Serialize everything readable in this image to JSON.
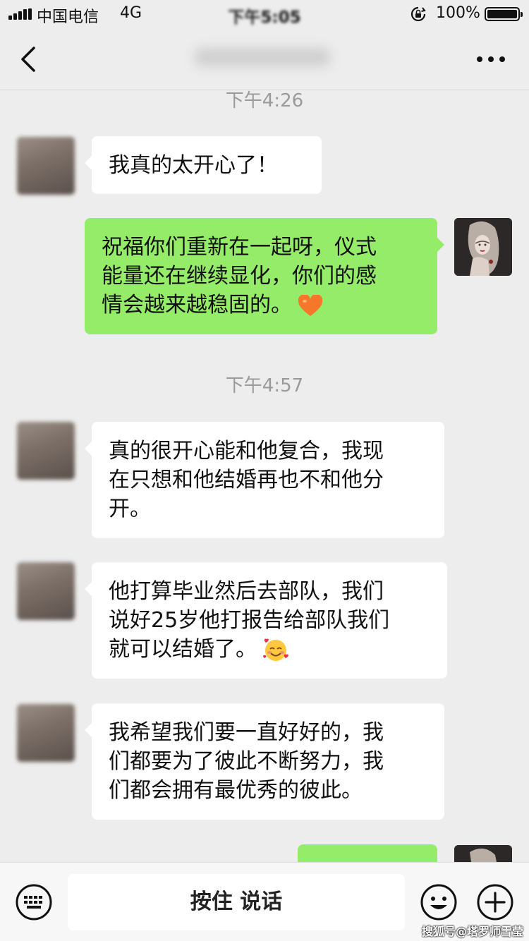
{
  "status_bar": {
    "carrier": "中国电信",
    "network": "4G",
    "time": "下午5:05",
    "battery_percent": "100%"
  },
  "nav": {
    "title": "",
    "back_icon": "chevron-left-icon",
    "more_icon": "more-dots-icon"
  },
  "chat": {
    "timestamps": [
      "下午4:26",
      "下午4:57"
    ],
    "messages": [
      {
        "side": "received",
        "lines": [
          "我真的太开心了！"
        ]
      },
      {
        "side": "sent",
        "lines": [
          "祝福你们重新在一起呀，仪式",
          "能量还在继续显化，你们的感",
          "情会越来越稳固的。"
        ],
        "emoji": "orange-heart"
      },
      {
        "side": "received",
        "lines": [
          "真的很开心能和他复合，我现",
          "在只想和他结婚再也不和他分",
          "开。"
        ]
      },
      {
        "side": "received",
        "lines": [
          "他打算毕业然后去部队，我们",
          "说好25岁他打报告给部队我们",
          "就可以结婚了。"
        ],
        "emoji": "smiling-face-with-hearts"
      },
      {
        "side": "received",
        "lines": [
          "我希望我们要一直好好的，我",
          "们都要为了彼此不断努力，我",
          "们都会拥有最优秀的彼此。"
        ]
      },
      {
        "side": "sent",
        "lines": []
      }
    ]
  },
  "input_bar": {
    "keyboard_icon": "keyboard-icon",
    "hold_to_talk_label": "按住 说话",
    "emoji_icon": "smiley-icon",
    "plus_icon": "plus-circle-icon"
  },
  "watermark": "搜狐号@塔罗师雪莹",
  "colors": {
    "background": "#ededed",
    "sent_bubble": "#95ec69",
    "received_bubble": "#ffffff",
    "timestamp": "#9a9a9a"
  }
}
